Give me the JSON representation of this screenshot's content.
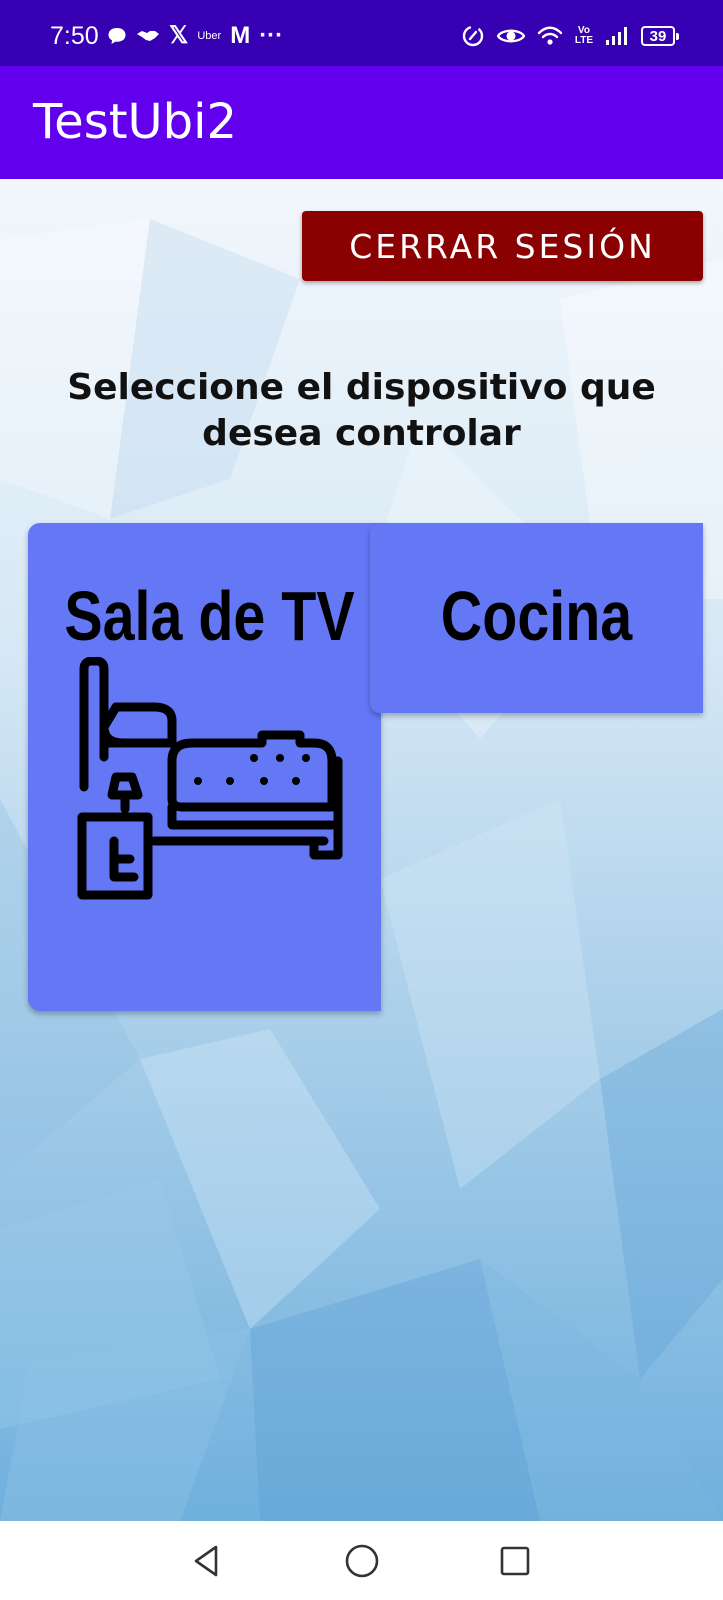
{
  "status_bar": {
    "time": "7:50",
    "left_icons": [
      "chat-bubble-icon",
      "handshake-icon",
      "x-logo-icon",
      "uber-icon",
      "gmail-icon",
      "more-dots-icon"
    ],
    "x_text": "𝕏",
    "uber_text": "Uber",
    "gmail_text": "M",
    "more_text": "···",
    "right_icons": [
      "data-saver-icon",
      "eye-icon",
      "wifi-icon",
      "volte-icon",
      "signal-icon",
      "battery-icon"
    ],
    "volte_top": "Vo",
    "volte_bottom": "LTE",
    "battery_level": "39"
  },
  "app_bar": {
    "title": "TestUbi2",
    "color": "#6200ee"
  },
  "main": {
    "logout_label": "CERRAR SESIÓN",
    "logout_color": "#8b0000",
    "prompt": "Seleccione el dispositivo que desea controlar",
    "cards": [
      {
        "label": "Sala de TV",
        "icon": "bed-nightstand-icon"
      },
      {
        "label": "Cocina"
      }
    ],
    "card_color": "#6478f5"
  },
  "nav_bar": {
    "buttons": [
      "back-icon",
      "home-icon",
      "recents-icon"
    ]
  }
}
